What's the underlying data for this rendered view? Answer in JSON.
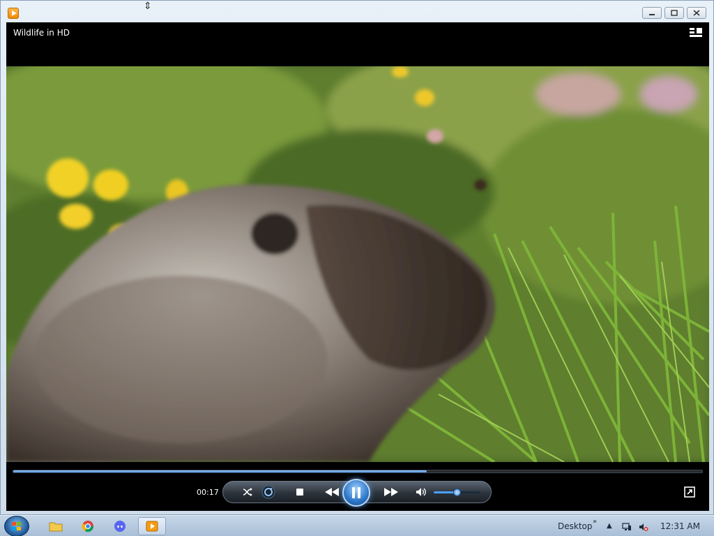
{
  "window": {
    "title_icon": "media-player-icon",
    "minimize_icon": "minimize-icon",
    "maximize_icon": "restore-icon",
    "close_icon": "close-icon"
  },
  "player": {
    "video_title": "Wildlife in HD",
    "elapsed_time": "00:17",
    "progress_fraction": 0.6,
    "volume_fraction": 0.5,
    "accent_color": "#3d86d9"
  },
  "controls": {
    "shuffle_icon": "shuffle-icon",
    "repeat_icon": "repeat-icon",
    "stop_icon": "stop-icon",
    "previous_icon": "previous-icon",
    "play_pause_icon": "pause-icon",
    "next_icon": "next-icon",
    "mute_icon": "speaker-icon",
    "fullscreen_icon": "fullscreen-icon",
    "switch_to_library_icon": "switch-to-library-icon"
  },
  "taskbar": {
    "desktop_label": "Desktop",
    "clock": "12:31 AM"
  }
}
